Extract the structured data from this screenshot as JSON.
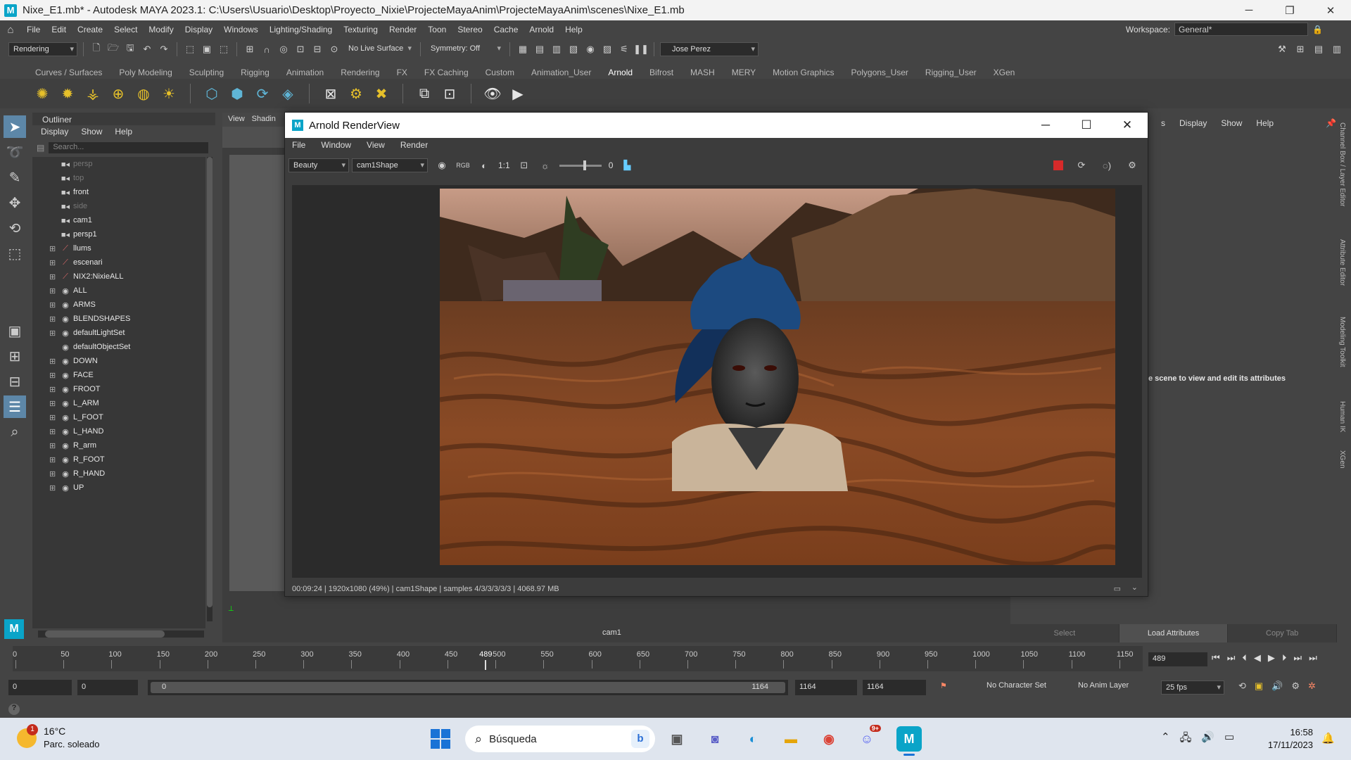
{
  "window": {
    "title": "Nixe_E1.mb* - Autodesk MAYA 2023.1: C:\\Users\\Usuario\\Desktop\\Proyecto_Nixie\\ProjecteMayaAnim\\ProjecteMayaAnim\\scenes\\Nixe_E1.mb",
    "app_icon": "M"
  },
  "menubar": {
    "items": [
      "File",
      "Edit",
      "Create",
      "Select",
      "Modify",
      "Display",
      "Windows",
      "Lighting/Shading",
      "Texturing",
      "Render",
      "Toon",
      "Stereo",
      "Cache",
      "Arnold",
      "Help"
    ],
    "workspace_label": "Workspace:",
    "workspace_value": "General*"
  },
  "statusline": {
    "menuset": "Rendering",
    "live_surface": "No Live Surface",
    "symmetry": "Symmetry: Off",
    "user": "Jose Perez"
  },
  "shelf": {
    "tabs": [
      "Curves / Surfaces",
      "Poly Modeling",
      "Sculpting",
      "Rigging",
      "Animation",
      "Rendering",
      "FX",
      "FX Caching",
      "Custom",
      "Animation_User",
      "Arnold",
      "Bifrost",
      "MASH",
      "MERY",
      "Motion Graphics",
      "Polygons_User",
      "Rigging_User",
      "XGen"
    ],
    "active_tab": "Arnold"
  },
  "outliner": {
    "title": "Outliner",
    "menu": [
      "Display",
      "Show",
      "Help"
    ],
    "search_placeholder": "Search...",
    "nodes": [
      {
        "label": "persp",
        "type": "camera",
        "dim": true,
        "expandable": false
      },
      {
        "label": "top",
        "type": "camera",
        "dim": true,
        "expandable": false
      },
      {
        "label": "front",
        "type": "camera",
        "dim": false,
        "expandable": false
      },
      {
        "label": "side",
        "type": "camera",
        "dim": true,
        "expandable": false
      },
      {
        "label": "cam1",
        "type": "camera",
        "dim": false,
        "expandable": false
      },
      {
        "label": "persp1",
        "type": "camera",
        "dim": false,
        "expandable": false
      },
      {
        "label": "llums",
        "type": "group",
        "dim": false,
        "expandable": true
      },
      {
        "label": "escenari",
        "type": "group",
        "dim": false,
        "expandable": true
      },
      {
        "label": "NIX2:NixieALL",
        "type": "group",
        "dim": false,
        "expandable": true
      },
      {
        "label": "ALL",
        "type": "set",
        "dim": false,
        "expandable": true
      },
      {
        "label": "ARMS",
        "type": "set",
        "dim": false,
        "expandable": true
      },
      {
        "label": "BLENDSHAPES",
        "type": "set",
        "dim": false,
        "expandable": true
      },
      {
        "label": "defaultLightSet",
        "type": "set",
        "dim": false,
        "expandable": true
      },
      {
        "label": "defaultObjectSet",
        "type": "set",
        "dim": false,
        "expandable": false
      },
      {
        "label": "DOWN",
        "type": "set",
        "dim": false,
        "expandable": true
      },
      {
        "label": "FACE",
        "type": "set",
        "dim": false,
        "expandable": true
      },
      {
        "label": "FROOT",
        "type": "set",
        "dim": false,
        "expandable": true
      },
      {
        "label": "L_ARM",
        "type": "set",
        "dim": false,
        "expandable": true
      },
      {
        "label": "L_FOOT",
        "type": "set",
        "dim": false,
        "expandable": true
      },
      {
        "label": "L_HAND",
        "type": "set",
        "dim": false,
        "expandable": true
      },
      {
        "label": "R_arm",
        "type": "set",
        "dim": false,
        "expandable": true
      },
      {
        "label": "R_FOOT",
        "type": "set",
        "dim": false,
        "expandable": true
      },
      {
        "label": "R_HAND",
        "type": "set",
        "dim": false,
        "expandable": true
      },
      {
        "label": "UP",
        "type": "set",
        "dim": false,
        "expandable": true
      }
    ]
  },
  "viewport": {
    "menu": [
      "View",
      "Shadin"
    ],
    "camera_label": "cam1"
  },
  "arnold": {
    "title": "Arnold RenderView",
    "menu": [
      "File",
      "Window",
      "View",
      "Render"
    ],
    "aov": "Beauty",
    "camera": "cam1Shape",
    "zoom": "1:1",
    "exposure": "0",
    "status": "00:09:24 | 1920x1080 (49%) | cam1Shape  | samples 4/3/3/3/3/3 | 4068.97 MB"
  },
  "attribute_panel": {
    "menu": [
      "s",
      "Display",
      "Show",
      "Help"
    ],
    "hint": "e scene to view and edit its attributes",
    "buttons": [
      "Select",
      "Load Attributes",
      "Copy Tab"
    ]
  },
  "sidetabs": [
    "Channel Box / Layer Editor",
    "Attribute Editor",
    "Modeling Toolkit",
    "Human IK",
    "XGen"
  ],
  "timeslider": {
    "ticks": [
      "0",
      "50",
      "100",
      "150",
      "200",
      "250",
      "300",
      "350",
      "400",
      "450",
      "500",
      "550",
      "600",
      "650",
      "700",
      "750",
      "800",
      "850",
      "900",
      "950",
      "1000",
      "1050",
      "1100",
      "1150"
    ],
    "current_frame": "489",
    "current_frame_field": "489"
  },
  "rangebar": {
    "scene_start": "0",
    "playback_start": "0",
    "range_start_label": "0",
    "range_end_label": "1164",
    "playback_end": "1164",
    "scene_end": "1164",
    "character_set": "No Character Set",
    "anim_layer": "No Anim Layer",
    "fps": "25 fps"
  },
  "taskbar": {
    "weather_temp": "16°C",
    "weather_desc": "Parc. soleado",
    "weather_badge": "1",
    "search_text": "Búsqueda",
    "discord_badge": "9+",
    "time": "16:58",
    "date": "17/11/2023"
  },
  "colors": {
    "maya_bg": "#444444",
    "active_tool": "#5d87a8",
    "taskbar": "#dfe5ee",
    "accent_blue": "#1a73d6"
  }
}
